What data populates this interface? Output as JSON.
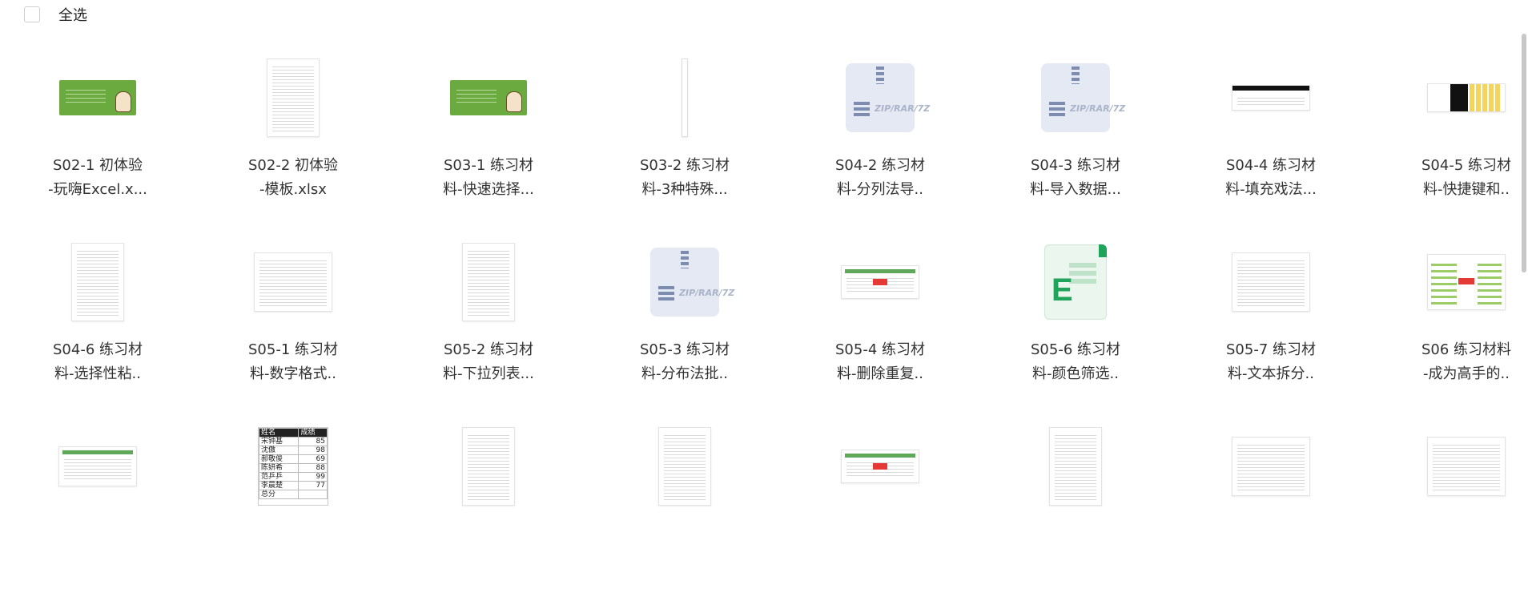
{
  "select_all": {
    "label": "全选",
    "checked": false
  },
  "files": [
    {
      "line1": "S02-1 初体验",
      "line2": "-玩嗨Excel.x...",
      "thumb": "green-slide-icon"
    },
    {
      "line1": "S02-2 初体验",
      "line2": "-模板.xlsx",
      "thumb": "sheet-tall-icon"
    },
    {
      "line1": "S03-1 练习材",
      "line2": "料-快速选择...",
      "thumb": "green-slide-icon"
    },
    {
      "line1": "S03-2 练习材",
      "line2": "料-3种特殊...",
      "thumb": "narrow-sheet-icon"
    },
    {
      "line1": "S04-2 练习材",
      "line2": "料-分列法导..",
      "thumb": "zip-icon"
    },
    {
      "line1": "S04-3 练习材",
      "line2": "料-导入数据...",
      "thumb": "zip-icon"
    },
    {
      "line1": "S04-4 练习材",
      "line2": "料-填充戏法...",
      "thumb": "wide-sheet-dark-icon"
    },
    {
      "line1": "S04-5 练习材",
      "line2": "料-快捷键和..",
      "thumb": "wide-sheet-yellow-icon"
    },
    {
      "line1": "S04-6 练习材",
      "line2": "料-选择性粘..",
      "thumb": "sheet-tall-icon"
    },
    {
      "line1": "S05-1 练习材",
      "line2": "料-数字格式..",
      "thumb": "sheet-wide-icon"
    },
    {
      "line1": "S05-2 练习材",
      "line2": "料-下拉列表...",
      "thumb": "sheet-tall-icon"
    },
    {
      "line1": "S05-3 练习材",
      "line2": "料-分布法批..",
      "thumb": "zip-icon"
    },
    {
      "line1": "S05-4 练习材",
      "line2": "料-删除重复..",
      "thumb": "sheet-red-rows-icon"
    },
    {
      "line1": "S05-6 练习材",
      "line2": "料-颜色筛选..",
      "thumb": "excel-file-icon"
    },
    {
      "line1": "S05-7 练习材",
      "line2": "料-文本拆分..",
      "thumb": "sheet-wide-icon"
    },
    {
      "line1": "S06 练习材料",
      "line2": "-成为高手的..",
      "thumb": "mindmap-icon"
    },
    {
      "line1": "",
      "line2": "",
      "thumb": "sheet-wide-green-icon"
    },
    {
      "line1": "",
      "line2": "",
      "thumb": "score-table-icon"
    },
    {
      "line1": "",
      "line2": "",
      "thumb": "sheet-tall-icon"
    },
    {
      "line1": "",
      "line2": "",
      "thumb": "sheet-tall-icon"
    },
    {
      "line1": "",
      "line2": "",
      "thumb": "sheet-red-rows-icon"
    },
    {
      "line1": "",
      "line2": "",
      "thumb": "sheet-tall-icon"
    },
    {
      "line1": "",
      "line2": "",
      "thumb": "sheet-wide-icon"
    },
    {
      "line1": "",
      "line2": "",
      "thumb": "sheet-wide-icon"
    }
  ],
  "score_table": {
    "headers": [
      "姓名",
      "成绩"
    ],
    "rows": [
      [
        "宋钟基",
        "85"
      ],
      [
        "沈傲",
        "98"
      ],
      [
        "郝敬俊",
        "69"
      ],
      [
        "陈妍希",
        "88"
      ],
      [
        "范乒乒",
        "99"
      ],
      [
        "李晨楚",
        "77"
      ],
      [
        "总分",
        ""
      ]
    ]
  },
  "zip_label": "ZIP/RAR/7Z",
  "excel_letter": "E",
  "colors": {
    "green": "#6aaa3f",
    "excel_green": "#20a35a",
    "zip_blue": "#7c8db0"
  }
}
